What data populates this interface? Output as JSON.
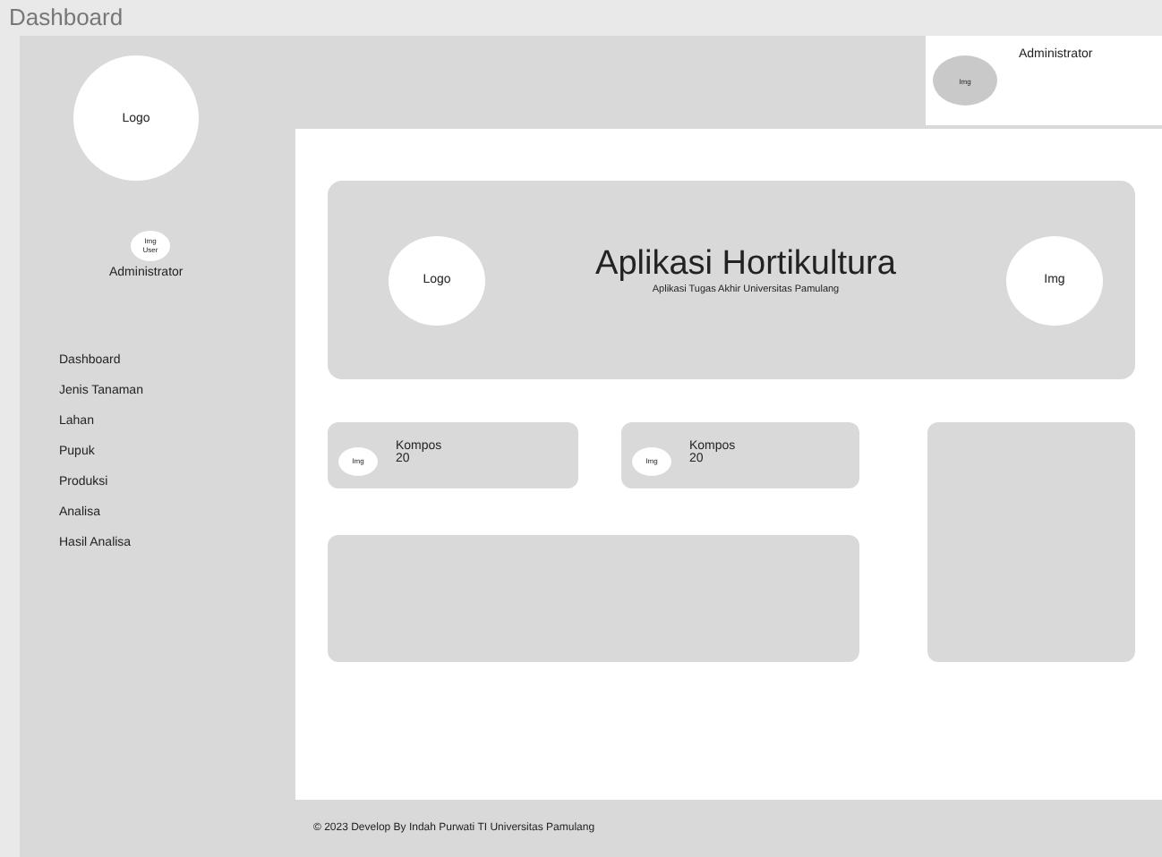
{
  "page_title": "Dashboard",
  "sidebar": {
    "logo": "Logo",
    "user_image": "Img User",
    "user_name": "Administrator",
    "items": [
      {
        "label": "Dashboard"
      },
      {
        "label": "Jenis Tanaman"
      },
      {
        "label": "Lahan"
      },
      {
        "label": "Pupuk"
      },
      {
        "label": "Produksi"
      },
      {
        "label": "Analisa"
      },
      {
        "label": "Hasil Analisa"
      }
    ]
  },
  "header_user": {
    "image": "Img",
    "name": "Administrator"
  },
  "banner": {
    "logo": "Logo",
    "title": "Aplikasi Hortikultura",
    "subtitle": "Aplikasi Tugas Akhir Universitas Pamulang",
    "image": "Img"
  },
  "stat_cards": [
    {
      "image": "Img",
      "label": "Kompos",
      "value": "20"
    },
    {
      "image": "Img",
      "label": "Kompos",
      "value": "20"
    }
  ],
  "footer": "© 2023 Develop By Indah Purwati TI Universitas Pamulang"
}
